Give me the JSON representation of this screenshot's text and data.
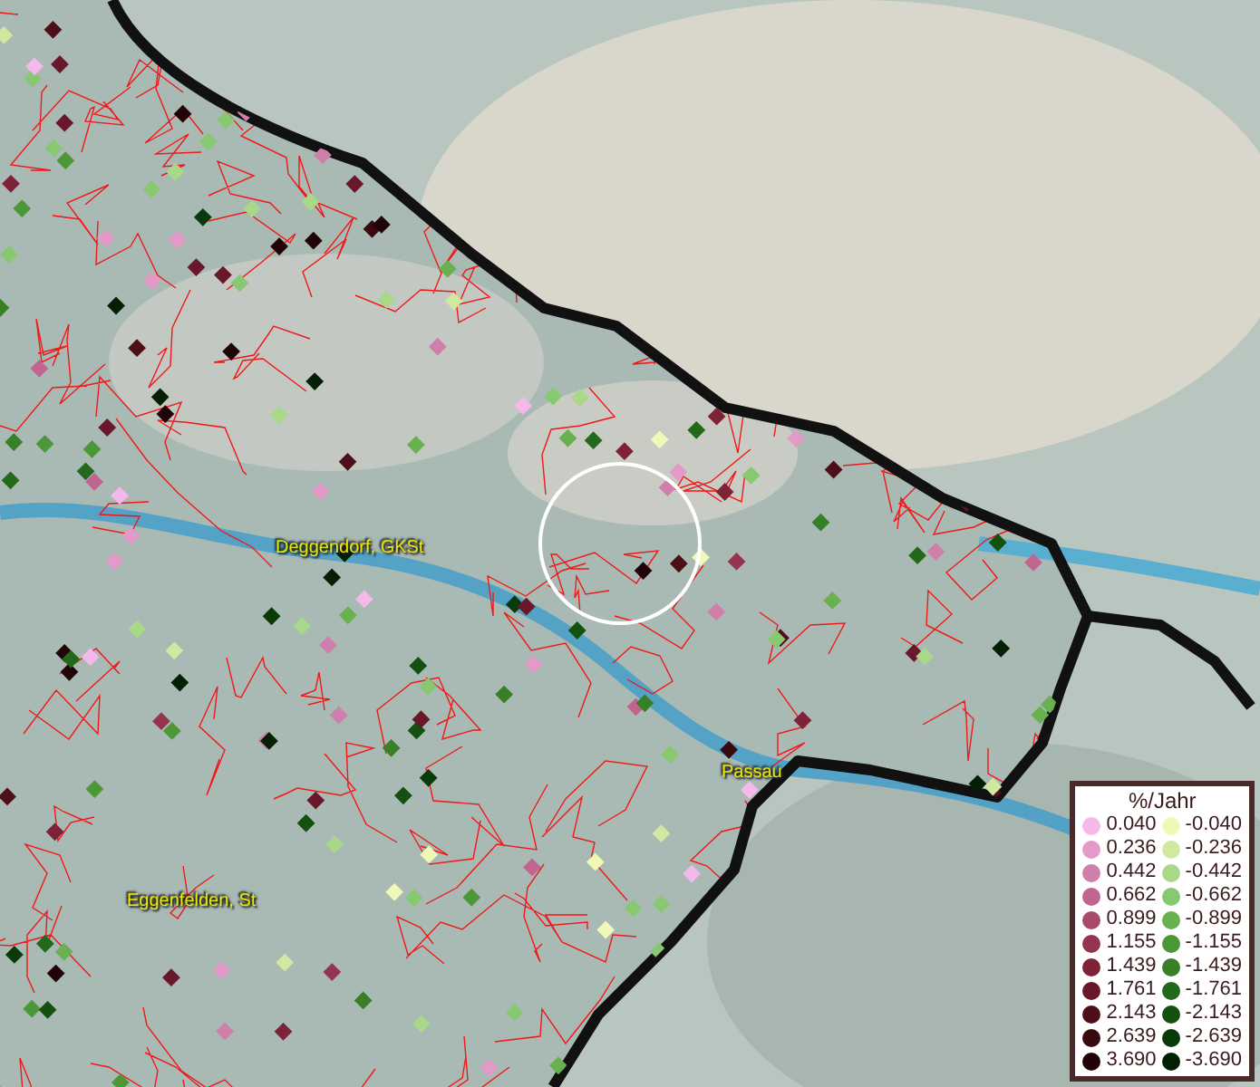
{
  "map": {
    "labels": [
      {
        "text": "Deggendorf, GKSt"
      },
      {
        "text": "Passau"
      },
      {
        "text": "Eggenfelden, St"
      }
    ]
  },
  "legend": {
    "title": "%/Jahr",
    "positive": [
      {
        "label": "0.040",
        "color": "#f5b8ea"
      },
      {
        "label": "0.236",
        "color": "#e49ac8"
      },
      {
        "label": "0.442",
        "color": "#d07eaa"
      },
      {
        "label": "0.662",
        "color": "#c06490"
      },
      {
        "label": "0.899",
        "color": "#a84a6a"
      },
      {
        "label": "1.155",
        "color": "#94344e"
      },
      {
        "label": "1.439",
        "color": "#7e2238"
      },
      {
        "label": "1.761",
        "color": "#68182a"
      },
      {
        "label": "2.143",
        "color": "#4e1018"
      },
      {
        "label": "2.639",
        "color": "#380a10"
      },
      {
        "label": "3.690",
        "color": "#200408"
      }
    ],
    "negative": [
      {
        "label": "-0.040",
        "color": "#f0f8b8"
      },
      {
        "label": "-0.236",
        "color": "#d0e8a0"
      },
      {
        "label": "-0.442",
        "color": "#a8d888"
      },
      {
        "label": "-0.662",
        "color": "#88c870"
      },
      {
        "label": "-0.899",
        "color": "#68b050"
      },
      {
        "label": "-1.155",
        "color": "#4c9838"
      },
      {
        "label": "-1.439",
        "color": "#388028"
      },
      {
        "label": "-1.761",
        "color": "#24681c"
      },
      {
        "label": "-2.143",
        "color": "#145010"
      },
      {
        "label": "-2.639",
        "color": "#0a3a08"
      },
      {
        "label": "-3.690",
        "color": "#042004"
      }
    ]
  }
}
